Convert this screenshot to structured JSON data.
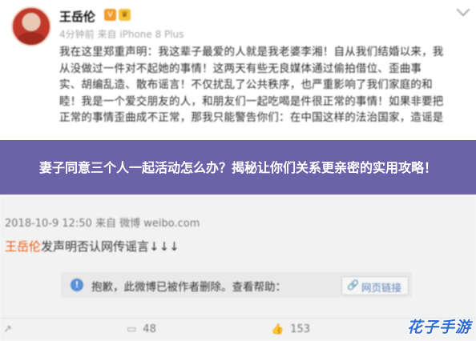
{
  "header": {
    "user_name": "王岳伦",
    "verified_badge": "V",
    "member_badge": "♛",
    "post_meta": "4分钟前 来自 iPhone 8 Plus"
  },
  "post": {
    "lines": [
      "我在这里郑重声明：我这辈子最爱的人就是我老婆李湘！自从我们结婚以来，我",
      "从没做过一件对不起她的事情！这两天有些无良媒体通过偷拍借位、歪曲事",
      "实、胡编乱造、散布谣言！不仅扰乱了公共秩序，也严重影响了我们家庭的和",
      "睦！我是一个爱交朋友的人，和朋友们一起吃喝是件很正常的事情！如果非要把",
      "正常的事情歪曲成不正常，那我只能警告你们：在中国这样的法治国家，造谣是"
    ]
  },
  "banner": {
    "title": "妻子同意三个人一起活动怎么办？揭秘让你们关系更亲密的实用攻略！"
  },
  "repost": {
    "meta": "2018-10-9 12:50 来自 微博 weibo.com",
    "mention": "王岳伦",
    "text": "发声明否认网传谣言↓↓↓",
    "deleted_notice": "抱歉，此微博已被作者删除。查看帮助：",
    "help_link": "网页链接"
  },
  "footer": {
    "share_count": "",
    "comment_count": "48",
    "like_count": "153"
  },
  "watermark": "花子手游",
  "colors": {
    "banner": "#6c62a8",
    "mention": "#e8590c",
    "link": "#5b7fb8",
    "watermark": "#2d6bd6"
  }
}
